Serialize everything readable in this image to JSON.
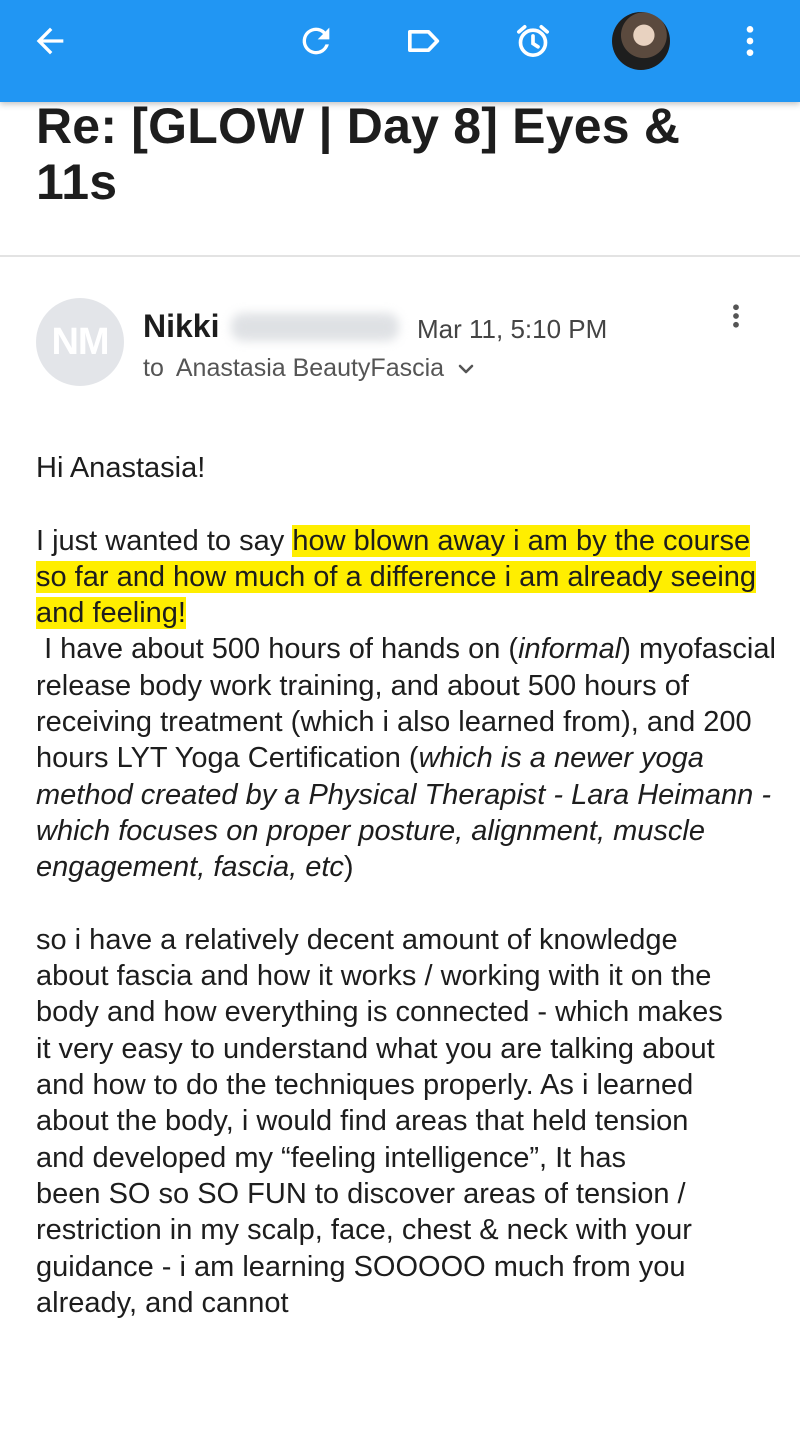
{
  "toolbar": {
    "back_icon": "arrow-left-icon",
    "refresh_icon": "refresh-icon",
    "label_icon": "label-tag-icon",
    "snooze_icon": "alarm-clock-icon",
    "more_icon": "more-vertical-icon",
    "color": "#2196f3"
  },
  "email": {
    "subject": "Re: [GLOW | Day 8] Eyes & 11s",
    "sender": {
      "initials": "NM",
      "first_name": "Nikki",
      "date": "Mar 11, 5:10 PM"
    },
    "to_label": "to",
    "recipient": "Anastasia BeautyFascia",
    "body": {
      "greeting": "Hi Anastasia!",
      "p1_lead": "I just wanted to say ",
      "p1_highlight": "how blown away i am by the course so far and how much of a difference i am already seeing and feeling!",
      "p2_a": " I have about 500 hours of hands on (",
      "p2_informal": "informal",
      "p2_b": ") myofascial release body work training, and about 500 hours of receiving treatment (which i also learned from), and 200 hours LYT Yoga Certification (",
      "p2_italic": "which is a newer yoga method created by a Physical Therapist - Lara Heimann - which focuses on proper posture, alignment, muscle engagement, fascia, etc",
      "p2_c": ")",
      "p3": "so i have a relatively decent amount of knowledge about fascia and how it works / working with it on the body and how everything is connected - which makes it very easy to understand what you are talking about and how to do the techniques properly. As i learned about the body, i would find areas that held tension and developed my “feeling intelligence”, It has",
      "p4": "been SO so SO FUN to discover areas of tension / restriction in my scalp, face, chest & neck with your guidance - i am learning SOOOOO much from you already, and cannot"
    },
    "highlight_color": "#ffee00"
  }
}
